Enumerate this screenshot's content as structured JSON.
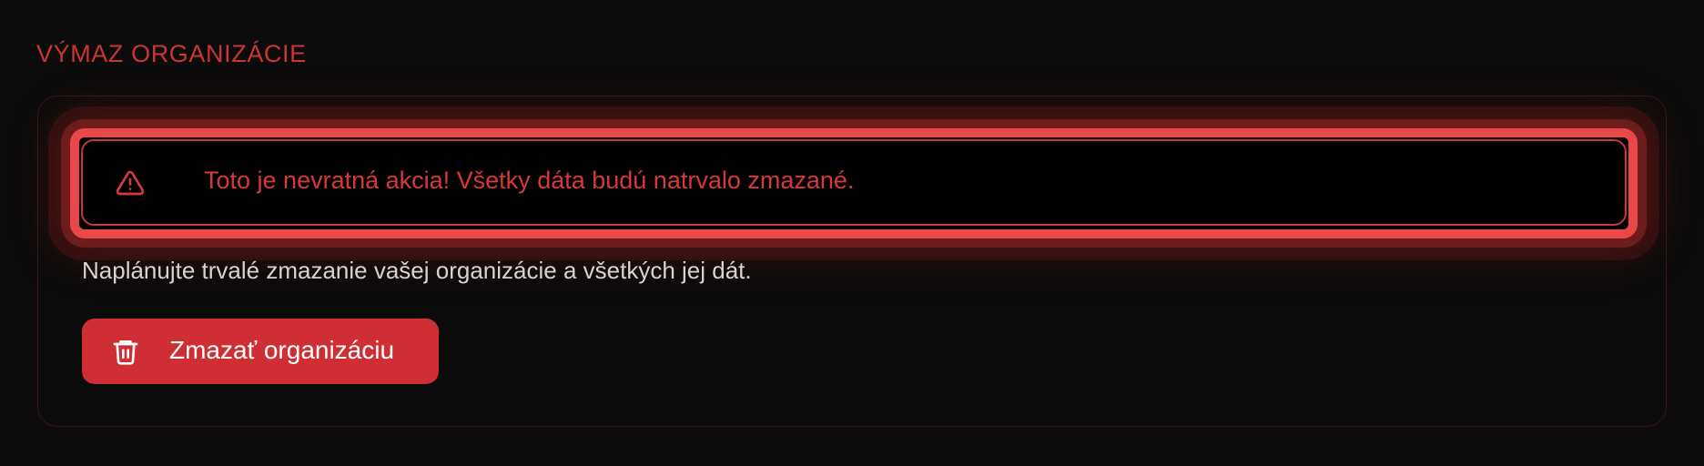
{
  "section": {
    "title": "VÝMAZ ORGANIZÁCIE"
  },
  "alert": {
    "icon": "warning-triangle-icon",
    "text": "Toto je nevratná akcia! Všetky dáta budú natrvalo zmazané."
  },
  "description": "Naplánujte trvalé zmazanie vašej organizácie a všetkých jej dát.",
  "delete_button": {
    "icon": "trash-icon",
    "label": "Zmazať organizáciu"
  },
  "colors": {
    "background": "#0b0b0b",
    "danger": "#cf2f34",
    "danger_text": "#d73838",
    "alert_ring": "#e94848",
    "body_text": "#d8d3cf",
    "card_border": "#3a1616"
  }
}
